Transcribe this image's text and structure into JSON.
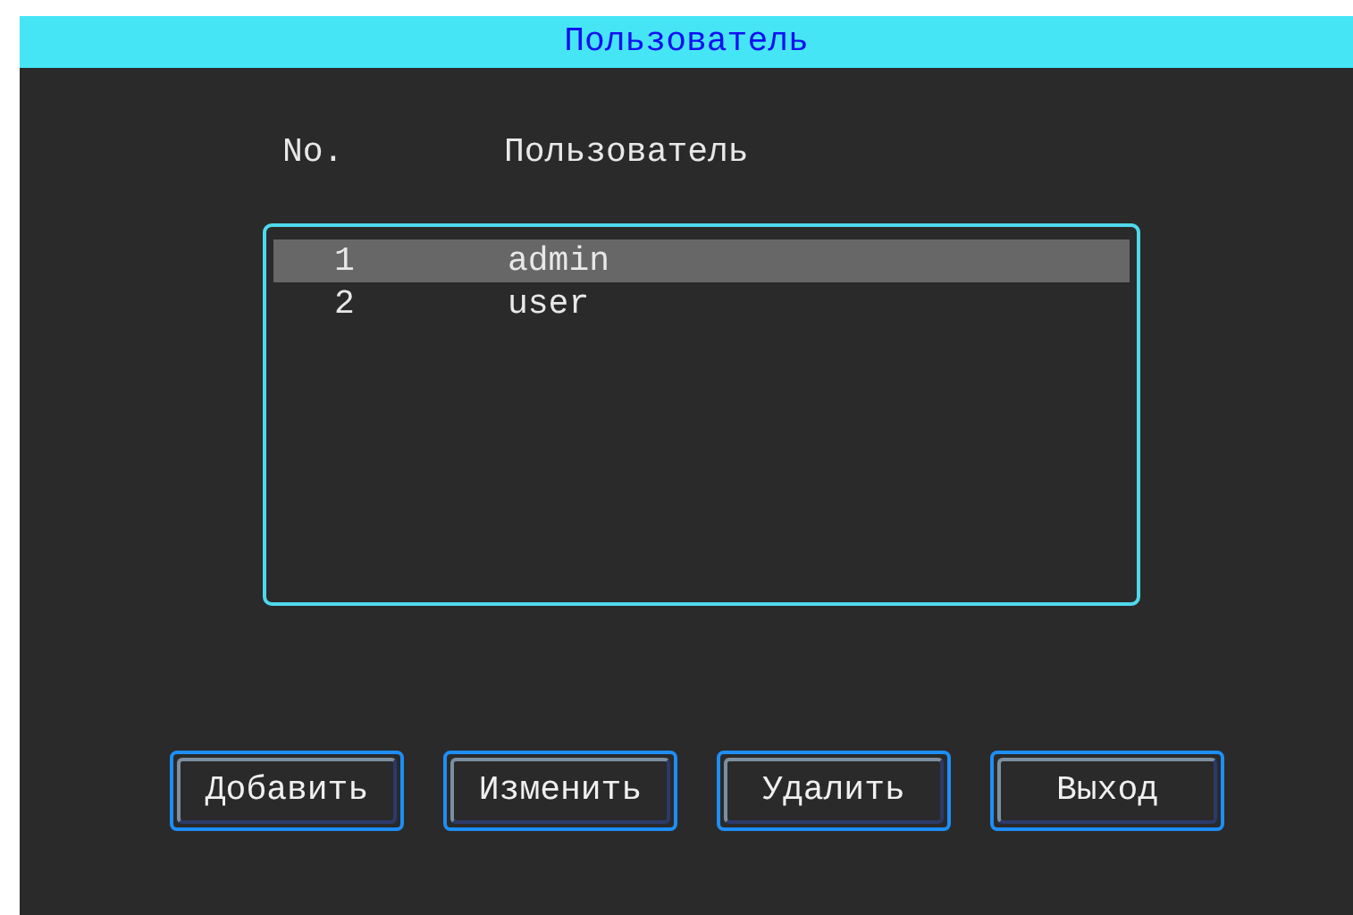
{
  "window": {
    "title": "Пользователь"
  },
  "table": {
    "columns": [
      "No.",
      "Пользователь"
    ],
    "rows": [
      {
        "cells": [
          "1",
          "admin"
        ],
        "selected": true
      },
      {
        "cells": [
          "2",
          "user"
        ],
        "selected": false
      }
    ]
  },
  "buttons": [
    "Добавить",
    "Изменить",
    "Удалить",
    "Выход"
  ]
}
